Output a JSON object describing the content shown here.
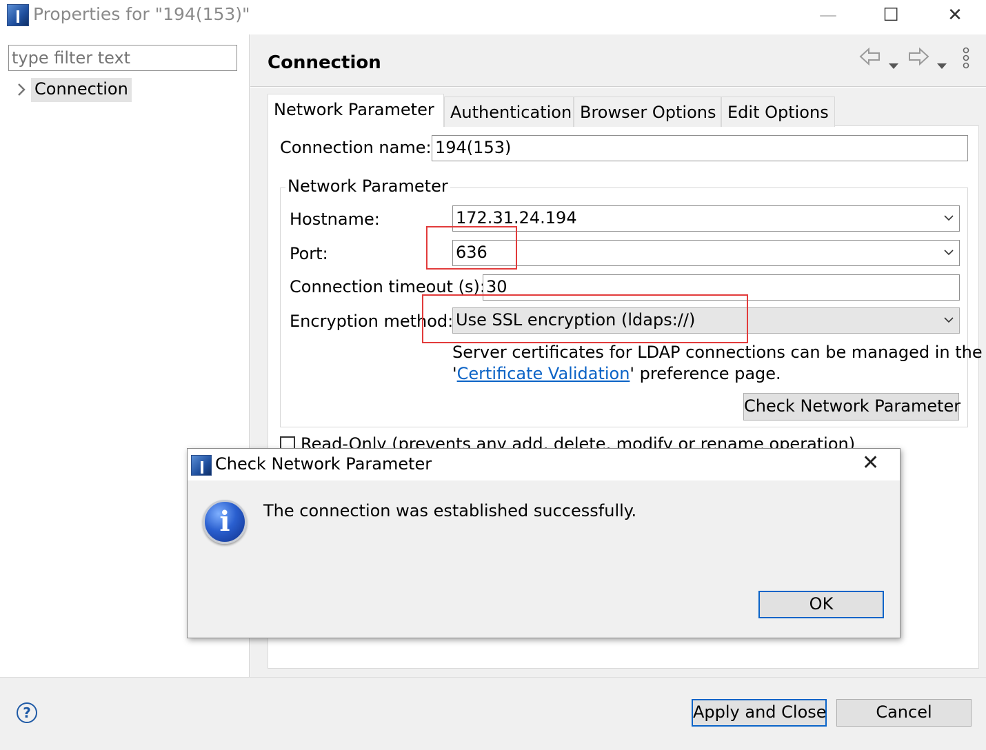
{
  "window": {
    "title": "Properties for \"194(153)\"",
    "minimize_glyph": "—",
    "maximize_glyph": "☐",
    "close_glyph": "✕"
  },
  "left": {
    "filter_placeholder": "type filter text",
    "tree": [
      {
        "label": "Connection",
        "selected": true
      }
    ]
  },
  "header": {
    "title": "Connection",
    "icons": [
      "back-arrow-icon",
      "dropdown-icon",
      "forward-arrow-icon",
      "dropdown-icon",
      "view-menu-icon"
    ]
  },
  "tabs": [
    {
      "label": "Network Parameter",
      "active": true
    },
    {
      "label": "Authentication",
      "active": false
    },
    {
      "label": "Browser Options",
      "active": false
    },
    {
      "label": "Edit Options",
      "active": false
    }
  ],
  "form": {
    "connection_name_label": "Connection name:",
    "connection_name_value": "194(153)",
    "group_title": "Network Parameter",
    "hostname_label": "Hostname:",
    "hostname_value": "172.31.24.194",
    "port_label": "Port:",
    "port_value": "636",
    "timeout_label": "Connection timeout (s):",
    "timeout_value": "30",
    "encryption_label": "Encryption method:",
    "encryption_value": "Use SSL encryption (ldaps://)",
    "cert_text_1": "Server certificates for LDAP connections can be managed in the",
    "cert_text_2_pre": "'",
    "cert_link": "Certificate Validation",
    "cert_text_2_post": "' preference page.",
    "check_button": "Check Network Parameter",
    "readonly_label": "Read-Only (prevents any add, delete, modify or rename operation)",
    "readonly_checked": false
  },
  "dialog": {
    "title": "Check Network Parameter",
    "close_glyph": "✕",
    "icon": "info-icon",
    "icon_glyph": "i",
    "message": "The connection was established successfully.",
    "ok_label": "OK"
  },
  "footer": {
    "help_glyph": "?",
    "apply_label": "Apply and Close",
    "cancel_label": "Cancel"
  },
  "colors": {
    "link": "#0b63c6",
    "highlight_box": "#e23b3b",
    "focus_border": "#0a64c8"
  }
}
